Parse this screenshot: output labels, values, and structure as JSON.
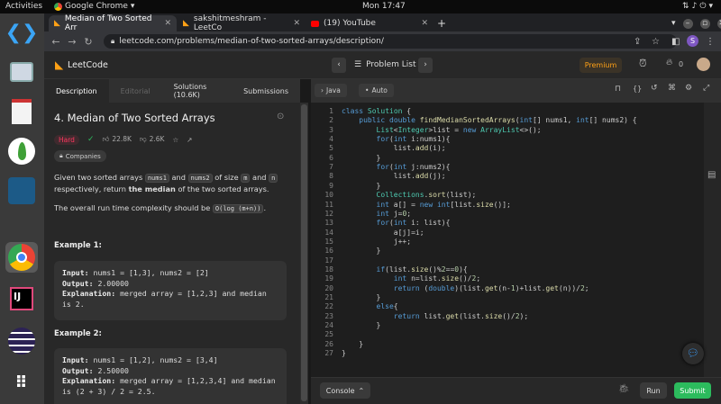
{
  "os": {
    "activities": "Activities",
    "app_name": "Google Chrome",
    "clock": "Mon 17:47"
  },
  "browser": {
    "tabs": [
      {
        "label": "Median of Two Sorted Arr",
        "active": true
      },
      {
        "label": "sakshitmeshram - LeetCo",
        "active": false
      },
      {
        "label": "(19) YouTube",
        "active": false
      }
    ],
    "new_tab": "+",
    "url": "leetcode.com/problems/median-of-two-sorted-arrays/description/",
    "profile_initial": "S"
  },
  "leetcode": {
    "logo_text": "LeetCode",
    "problem_list": "Problem List",
    "premium": "Premium",
    "streak_count": "0",
    "left_tabs": [
      "Description",
      "Editorial",
      "Solutions (10.6K)",
      "Submissions"
    ],
    "title": "4. Median of Two Sorted Arrays",
    "difficulty": "Hard",
    "likes": "22.8K",
    "dislikes": "2.6K",
    "companies": "Companies",
    "desc_p1_a": "Given two sorted arrays",
    "desc_p1_nums1": "nums1",
    "desc_p1_and": "and",
    "desc_p1_nums2": "nums2",
    "desc_p1_size": "of size",
    "desc_p1_m": "m",
    "desc_p1_and2": "and",
    "desc_p1_n": "n",
    "desc_p1_b": "respectively, return",
    "desc_p1_bold": "the median",
    "desc_p1_c": "of the two sorted arrays.",
    "desc_p2": "The overall run time complexity should be",
    "desc_p2_code": "O(log (m+n))",
    "desc_p2_end": ".",
    "example1_title": "Example 1:",
    "example1": {
      "input_label": "Input:",
      "input": "nums1 = [1,3], nums2 = [2]",
      "output_label": "Output:",
      "output": "2.00000",
      "expl_label": "Explanation:",
      "expl_1": "merged array = [1,2,3] and median",
      "expl_2": "is 2."
    },
    "example2_title": "Example 2:",
    "example2": {
      "input_label": "Input:",
      "input": "nums1 = [1,2], nums2 = [3,4]",
      "output_label": "Output:",
      "output": "2.50000",
      "expl_label": "Explanation:",
      "expl_1": "merged array = [1,2,3,4] and median",
      "expl_2": "is (2 + 3) / 2 = 2.5."
    },
    "language": "Java",
    "auto": "Auto",
    "console": "Console",
    "run": "Run",
    "submit": "Submit"
  },
  "code_lines": [
    "class Solution {",
    "    public double findMedianSortedArrays(int[] nums1, int[] nums2) {",
    "        List<Integer>list = new ArrayList<>();",
    "        for(int i:nums1){",
    "            list.add(i);",
    "        }",
    "        for(int j:nums2){",
    "            list.add(j);",
    "        }",
    "        Collections.sort(list);",
    "        int a[] = new int[list.size()];",
    "        int j=0;",
    "        for(int i: list){",
    "            a[j]=i;",
    "            j++;",
    "        }",
    "",
    "        if(list.size()%2==0){",
    "            int n=list.size()/2;",
    "            return (double)(list.get(n-1)+list.get(n))/2;",
    "        }",
    "        else{",
    "            return list.get(list.size()/2);",
    "        }",
    "",
    "    }",
    "}"
  ],
  "colors": {
    "accent_orange": "#ffa116",
    "hard_red": "#ff375f",
    "submit_green": "#2cbb5d"
  }
}
